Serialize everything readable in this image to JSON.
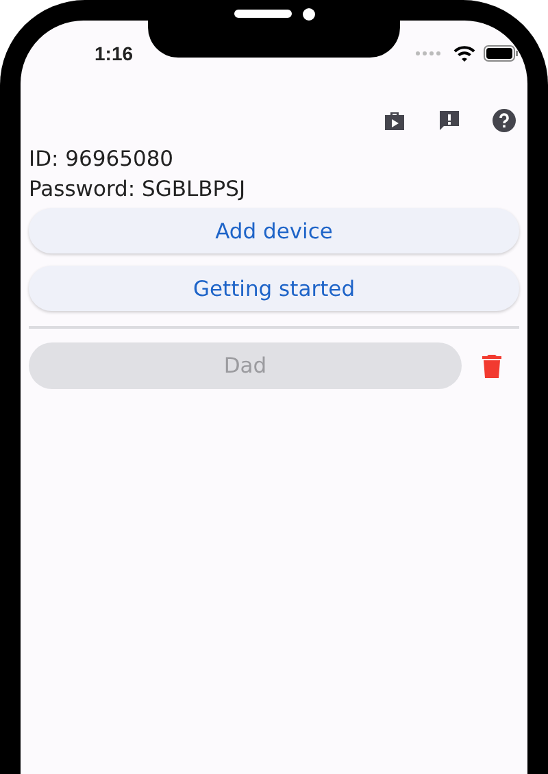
{
  "status_bar": {
    "time": "1:16"
  },
  "toolbar": {
    "actions": [
      {
        "kind": "store"
      },
      {
        "kind": "feedback"
      },
      {
        "kind": "help"
      }
    ]
  },
  "account": {
    "id": "ID: 96965080",
    "password": "Password: SGBLBPSJ"
  },
  "buttons": [
    {
      "label": "Add device"
    },
    {
      "label": "Getting started"
    }
  ],
  "devices": [
    {
      "name": "Dad",
      "disabled": true
    }
  ]
}
